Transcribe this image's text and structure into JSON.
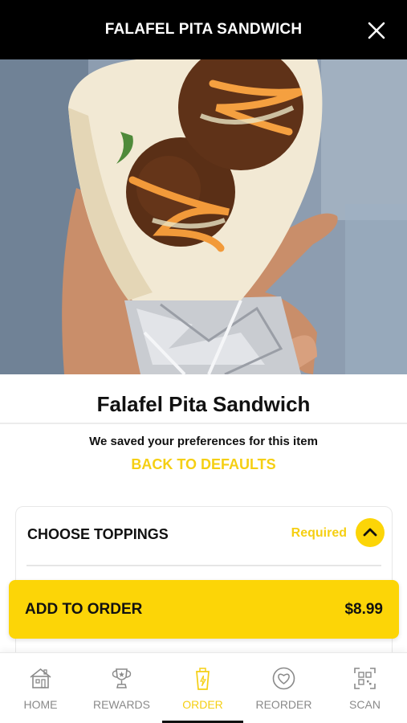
{
  "header": {
    "title": "FALAFEL PITA SANDWICH",
    "close_icon": "close-icon"
  },
  "item": {
    "name": "Falafel Pita Sandwich"
  },
  "preferences": {
    "saved_text": "We saved your preferences for this item",
    "reset_label": "BACK TO DEFAULTS"
  },
  "toppings": {
    "label": "CHOOSE TOPPINGS",
    "status": "Required",
    "toggle_icon": "chevron-up-icon"
  },
  "order": {
    "add_label": "ADD TO ORDER",
    "price": "$8.99"
  },
  "tabs": [
    {
      "label": "HOME",
      "icon": "house-icon"
    },
    {
      "label": "REWARDS",
      "icon": "trophy-icon"
    },
    {
      "label": "ORDER",
      "icon": "cup-icon",
      "active": true
    },
    {
      "label": "REORDER",
      "icon": "heart-icon"
    },
    {
      "label": "SCAN",
      "icon": "qr-code-icon"
    }
  ],
  "colors": {
    "accent": "#fcd507",
    "accent_text": "#f5cf13",
    "header_bg": "#000000",
    "inactive": "#8a8a8a"
  }
}
